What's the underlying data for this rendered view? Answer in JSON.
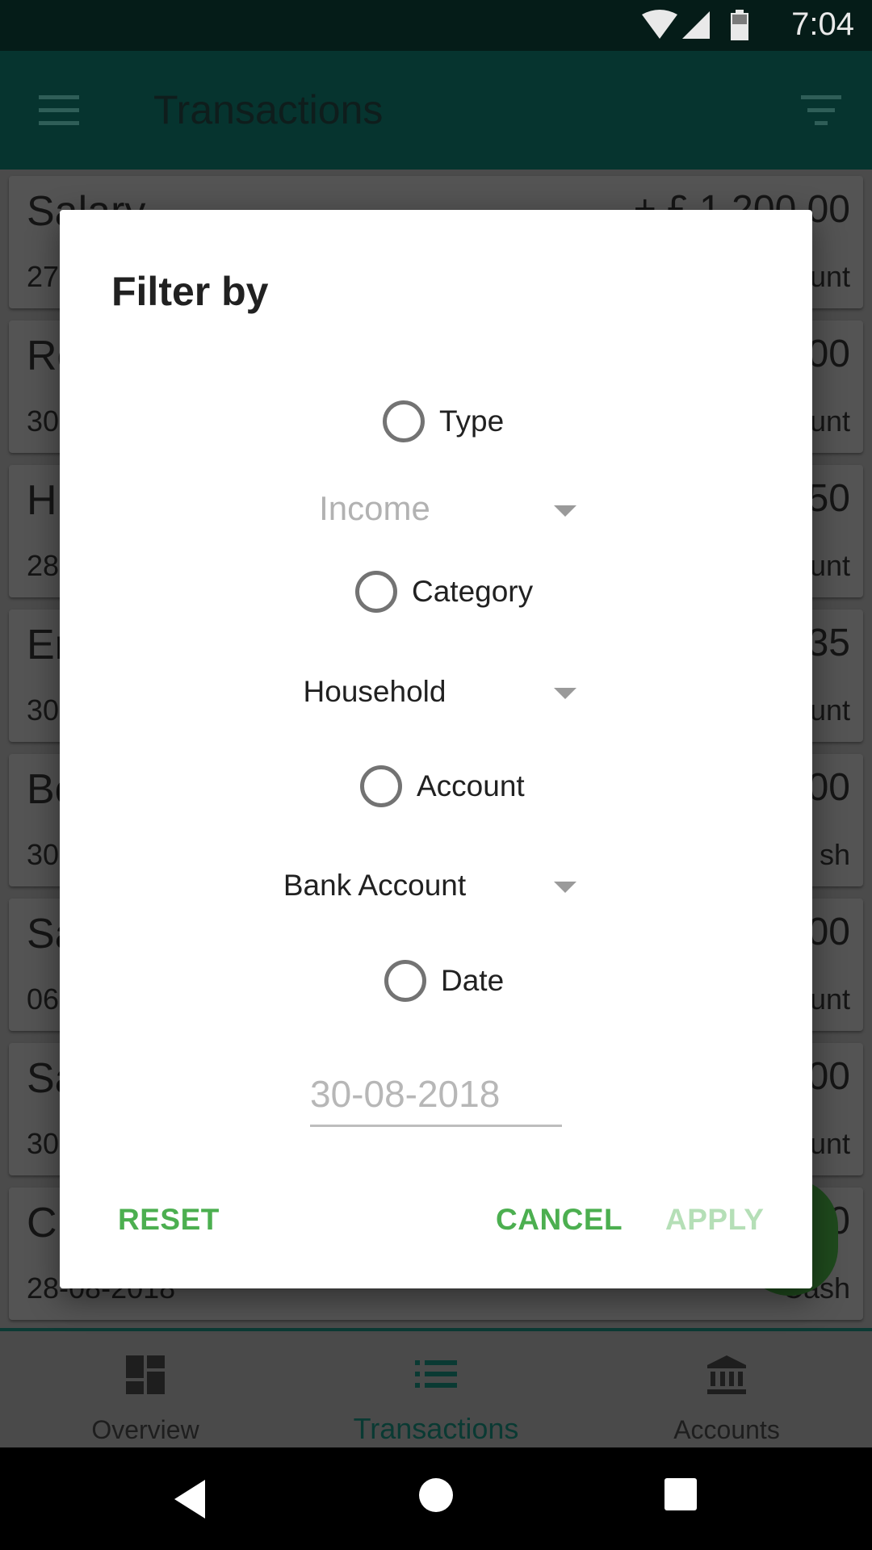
{
  "status_bar": {
    "time": "7:04"
  },
  "app_bar": {
    "title": "Transactions"
  },
  "transactions": [
    {
      "name": "Salary",
      "amount": "+ £ 1,200.00",
      "date": "27",
      "account": "unt"
    },
    {
      "name": "Re",
      "amount": "00",
      "date": "30",
      "account": "unt"
    },
    {
      "name": "H",
      "amount": "50",
      "date": "28",
      "account": "unt"
    },
    {
      "name": "Er",
      "amount": "35",
      "date": "30",
      "account": "unt"
    },
    {
      "name": "Bo",
      "amount": "00",
      "date": "30",
      "account": "sh"
    },
    {
      "name": "Sa",
      "amount": "00",
      "date": "06",
      "account": "unt"
    },
    {
      "name": "Sa",
      "amount": "00",
      "date": "30",
      "account": "unt"
    },
    {
      "name": "Cl",
      "amount": "0",
      "date": "28-08-2018",
      "account": "Cash"
    }
  ],
  "dialog": {
    "title": "Filter by",
    "type_label": "Type",
    "type_value": "Income",
    "category_label": "Category",
    "category_value": "Household",
    "account_label": "Account",
    "account_value": "Bank Account",
    "date_label": "Date",
    "date_placeholder": "30-08-2018",
    "reset_label": "RESET",
    "cancel_label": "CANCEL",
    "apply_label": "APPLY"
  },
  "bottom_nav": {
    "overview": "Overview",
    "transactions": "Transactions",
    "accounts": "Accounts"
  },
  "icons": [
    "menu-icon",
    "filter-icon",
    "wifi-icon",
    "signal-icon",
    "battery-icon",
    "overview-icon",
    "list-icon",
    "bank-icon",
    "back-icon",
    "home-icon",
    "recents-icon"
  ],
  "colors": {
    "accent": "#4caf50",
    "primary_dark": "#06342f"
  }
}
